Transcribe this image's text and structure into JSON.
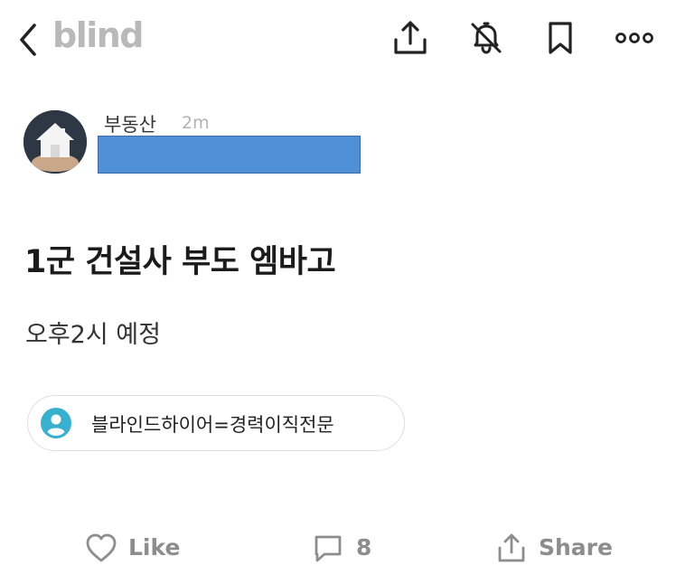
{
  "header": {
    "logo_text": "blind",
    "icons": [
      "back-chevron-icon",
      "share-icon",
      "bell-off-icon",
      "bookmark-icon",
      "more-icon"
    ]
  },
  "post": {
    "channel": "부동산",
    "time_ago": "2m",
    "title": "1군 건설사 부도 엠바고",
    "body": "오후2시 예정"
  },
  "author_tag": {
    "text": "블라인드하이어=경력이직전문",
    "icon": "person-icon"
  },
  "actions": {
    "like_label": "Like",
    "comment_count": "8",
    "share_label": "Share"
  },
  "colors": {
    "logo": "#b9b9b9",
    "redaction": "#4f8fd6",
    "tag_icon": "#3ab0cf",
    "action_text": "#8d8d8d"
  }
}
